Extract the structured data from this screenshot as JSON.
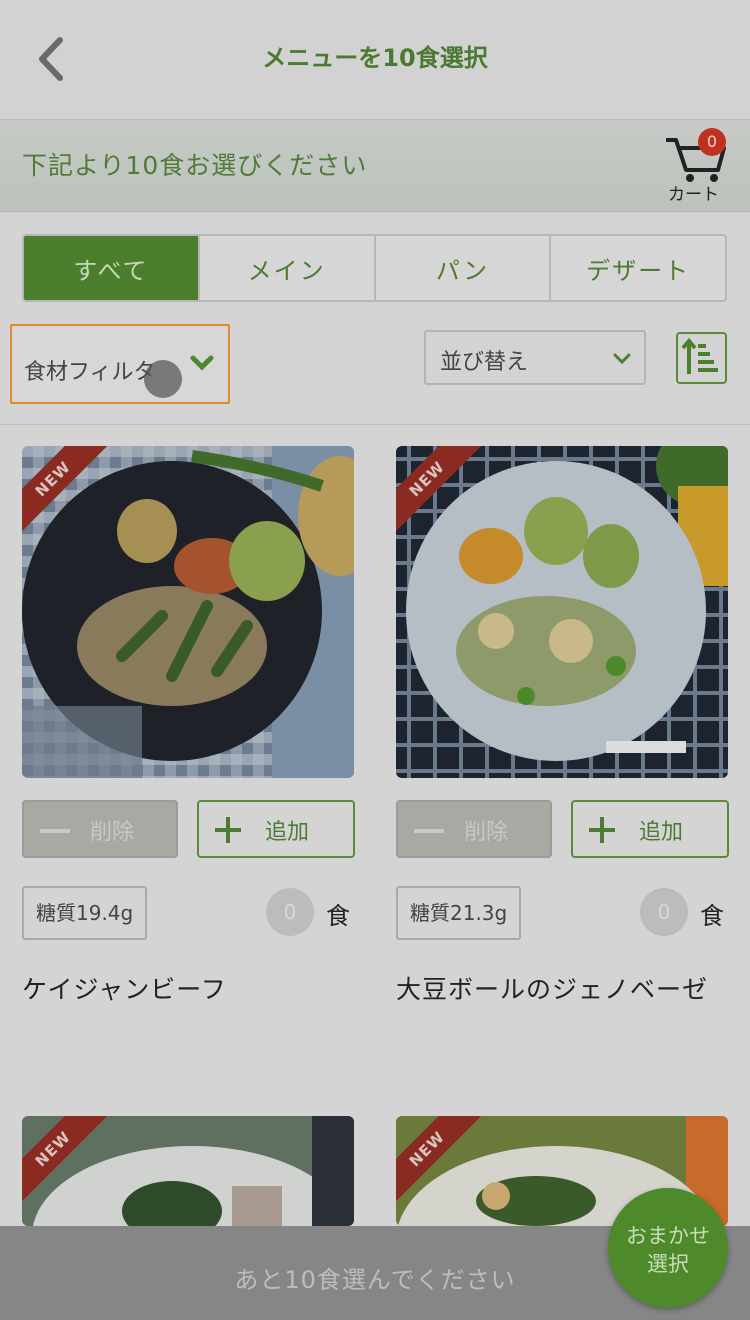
{
  "header": {
    "title": "メニューを10食選択",
    "subtitle": "下記より10食お選びください",
    "cart_label": "カート",
    "cart_count": "0"
  },
  "tabs": [
    {
      "label": "すべて",
      "active": true
    },
    {
      "label": "メイン",
      "active": false
    },
    {
      "label": "パン",
      "active": false
    },
    {
      "label": "デザート",
      "active": false
    }
  ],
  "filter": {
    "label": "食材フィルタ"
  },
  "sort": {
    "label": "並び替え"
  },
  "products": [
    {
      "badge": "NEW",
      "delete_label": "削除",
      "add_label": "追加",
      "carb": "糖質19.4g",
      "count": "0",
      "unit": "食",
      "name": "ケイジャンビーフ"
    },
    {
      "badge": "NEW",
      "delete_label": "削除",
      "add_label": "追加",
      "carb": "糖質21.3g",
      "count": "0",
      "unit": "食",
      "name": "大豆ボールのジェノベーゼ"
    },
    {
      "badge": "NEW"
    },
    {
      "badge": "NEW"
    }
  ],
  "footer": {
    "remaining_text": "あと10食選んでください",
    "omakase_line1": "おまかせ",
    "omakase_line2": "選択"
  },
  "colors": {
    "accent": "#4b7f2d",
    "filter_border": "#e08a2a",
    "badge": "#c0321f"
  }
}
